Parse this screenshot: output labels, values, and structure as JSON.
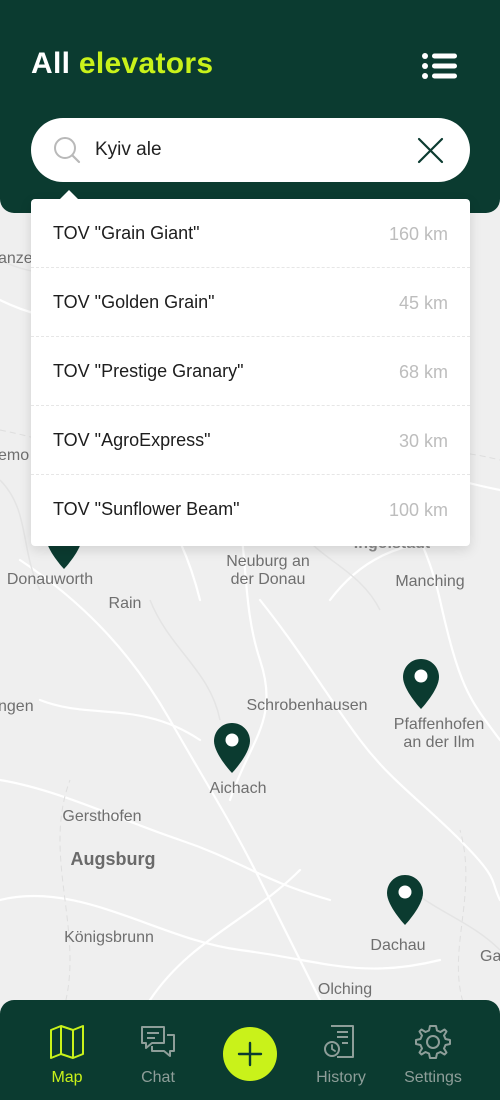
{
  "header": {
    "title_part1": "All",
    "title_part2": "elevators",
    "menu_icon": "list-menu-icon"
  },
  "search": {
    "value": "Kyiv ale",
    "placeholder": "",
    "search_icon": "search-icon",
    "clear_icon": "close-icon"
  },
  "dropdown": {
    "items": [
      {
        "name": "TOV \"Grain Giant\"",
        "distance": "160 km"
      },
      {
        "name": "TOV \"Golden Grain\"",
        "distance": "45 km"
      },
      {
        "name": "TOV \"Prestige Granary\"",
        "distance": "68 km"
      },
      {
        "name": "TOV \"AgroExpress\"",
        "distance": "30 km"
      },
      {
        "name": "TOV \"Sunflower Beam\"",
        "distance": "100 km"
      }
    ]
  },
  "map": {
    "places": {
      "anzer": "anzer",
      "emo": "emo",
      "donauworth": "Donauworth",
      "rain": "Rain",
      "neuburg": "Neuburg an\nder Donau",
      "ingolstadt": "Ingolstadt",
      "manching": "Manching",
      "ngen": "ngen",
      "schrobenhausen": "Schrobenhausen",
      "pfaffenhofen": "Pfaffenhofen\nan der Ilm",
      "aichach": "Aichach",
      "gersthofen": "Gersthofen",
      "augsburg": "Augsburg",
      "konigsbrunn": "Königsbrunn",
      "dachau": "Dachau",
      "ga": "Ga",
      "olching": "Olching"
    },
    "pin_icon": "map-pin-icon"
  },
  "bottom_nav": {
    "items": [
      {
        "label": "Map",
        "icon": "map-icon",
        "active": true
      },
      {
        "label": "Chat",
        "icon": "chat-icon",
        "active": false
      },
      {
        "label": "",
        "icon": "plus-icon",
        "active": false
      },
      {
        "label": "History",
        "icon": "history-document-icon",
        "active": false
      },
      {
        "label": "Settings",
        "icon": "gear-icon",
        "active": false
      }
    ]
  },
  "colors": {
    "primary_dark_green": "#0b3b30",
    "accent_lime": "#c9f21a",
    "inactive_nav": "#8e9e99",
    "distance_text": "#bdbdbd"
  }
}
